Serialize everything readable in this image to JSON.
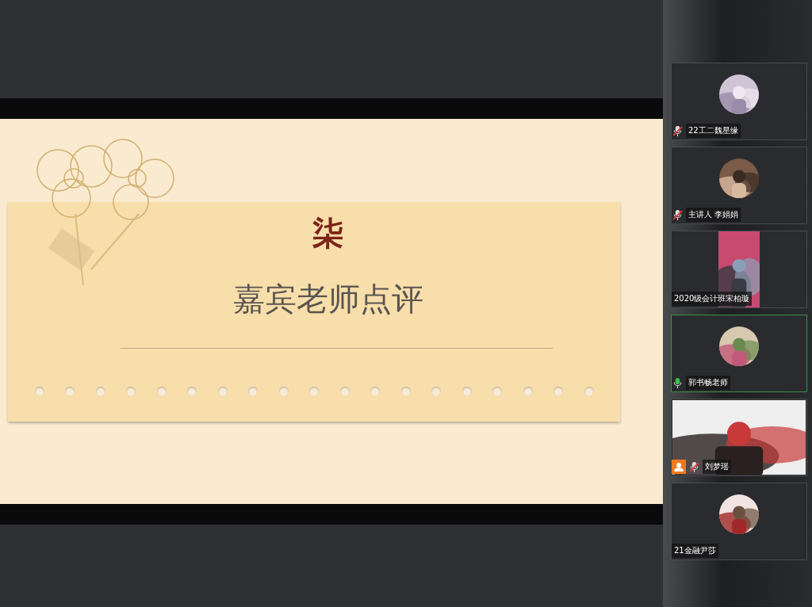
{
  "slide": {
    "number": "柒",
    "title": "嘉宾老师点评"
  },
  "participants": [
    {
      "name": "22工二魏星缘",
      "kind": "avatar",
      "mic_icon": true,
      "muted": true,
      "speaking": false,
      "host": false
    },
    {
      "name": "主讲人 李娟娟",
      "kind": "avatar",
      "mic_icon": true,
      "muted": true,
      "speaking": false,
      "host": false
    },
    {
      "name": "2020级会计班宋柏璇",
      "kind": "portrait",
      "mic_icon": false,
      "speaking": false,
      "host": false
    },
    {
      "name": "郭书畅老师",
      "kind": "avatar",
      "mic_icon": true,
      "muted": false,
      "speaking": true,
      "host": false
    },
    {
      "name": "刘梦瑶",
      "kind": "video",
      "mic_icon": true,
      "muted": true,
      "speaking": false,
      "host": true
    },
    {
      "name": "21金融尹莎",
      "kind": "avatar",
      "mic_icon": false,
      "speaking": false,
      "host": false
    }
  ]
}
